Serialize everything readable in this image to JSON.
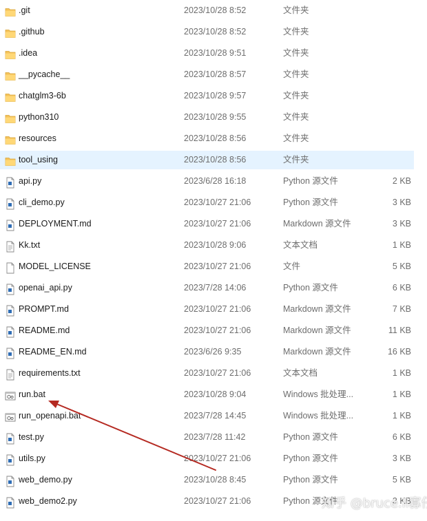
{
  "files": [
    {
      "name": ".git",
      "date": "2023/10/28 8:52",
      "type": "文件夹",
      "size": "",
      "icon": "folder-icon"
    },
    {
      "name": ".github",
      "date": "2023/10/28 8:52",
      "type": "文件夹",
      "size": "",
      "icon": "folder-icon"
    },
    {
      "name": ".idea",
      "date": "2023/10/28 9:51",
      "type": "文件夹",
      "size": "",
      "icon": "folder-icon"
    },
    {
      "name": "__pycache__",
      "date": "2023/10/28 8:57",
      "type": "文件夹",
      "size": "",
      "icon": "folder-icon"
    },
    {
      "name": "chatglm3-6b",
      "date": "2023/10/28 9:57",
      "type": "文件夹",
      "size": "",
      "icon": "folder-icon"
    },
    {
      "name": "python310",
      "date": "2023/10/28 9:55",
      "type": "文件夹",
      "size": "",
      "icon": "folder-icon"
    },
    {
      "name": "resources",
      "date": "2023/10/28 8:56",
      "type": "文件夹",
      "size": "",
      "icon": "folder-icon"
    },
    {
      "name": "tool_using",
      "date": "2023/10/28 8:56",
      "type": "文件夹",
      "size": "",
      "icon": "folder-icon",
      "selected": true
    },
    {
      "name": "api.py",
      "date": "2023/6/28 16:18",
      "type": "Python 源文件",
      "size": "2 KB",
      "icon": "python-file-icon"
    },
    {
      "name": "cli_demo.py",
      "date": "2023/10/27 21:06",
      "type": "Python 源文件",
      "size": "3 KB",
      "icon": "python-file-icon"
    },
    {
      "name": "DEPLOYMENT.md",
      "date": "2023/10/27 21:06",
      "type": "Markdown 源文件",
      "size": "3 KB",
      "icon": "markdown-file-icon"
    },
    {
      "name": "Kk.txt",
      "date": "2023/10/28 9:06",
      "type": "文本文档",
      "size": "1 KB",
      "icon": "text-file-icon"
    },
    {
      "name": "MODEL_LICENSE",
      "date": "2023/10/27 21:06",
      "type": "文件",
      "size": "5 KB",
      "icon": "blank-file-icon"
    },
    {
      "name": "openai_api.py",
      "date": "2023/7/28 14:06",
      "type": "Python 源文件",
      "size": "6 KB",
      "icon": "python-file-icon"
    },
    {
      "name": "PROMPT.md",
      "date": "2023/10/27 21:06",
      "type": "Markdown 源文件",
      "size": "7 KB",
      "icon": "markdown-file-icon"
    },
    {
      "name": "README.md",
      "date": "2023/10/27 21:06",
      "type": "Markdown 源文件",
      "size": "11 KB",
      "icon": "markdown-file-icon"
    },
    {
      "name": "README_EN.md",
      "date": "2023/6/26 9:35",
      "type": "Markdown 源文件",
      "size": "16 KB",
      "icon": "markdown-file-icon"
    },
    {
      "name": "requirements.txt",
      "date": "2023/10/27 21:06",
      "type": "文本文档",
      "size": "1 KB",
      "icon": "text-file-icon"
    },
    {
      "name": "run.bat",
      "date": "2023/10/28 9:04",
      "type": "Windows 批处理...",
      "size": "1 KB",
      "icon": "batch-file-icon"
    },
    {
      "name": "run_openapi.bat",
      "date": "2023/7/28 14:45",
      "type": "Windows 批处理...",
      "size": "1 KB",
      "icon": "batch-file-icon"
    },
    {
      "name": "test.py",
      "date": "2023/7/28 11:42",
      "type": "Python 源文件",
      "size": "6 KB",
      "icon": "python-file-icon"
    },
    {
      "name": "utils.py",
      "date": "2023/10/27 21:06",
      "type": "Python 源文件",
      "size": "3 KB",
      "icon": "python-file-icon"
    },
    {
      "name": "web_demo.py",
      "date": "2023/10/28 8:45",
      "type": "Python 源文件",
      "size": "5 KB",
      "icon": "python-file-icon"
    },
    {
      "name": "web_demo2.py",
      "date": "2023/10/27 21:06",
      "type": "Python 源文件",
      "size": "3 KB",
      "icon": "python-file-icon"
    }
  ],
  "annotation": {
    "color": "#b52a22"
  },
  "watermark": {
    "text": "知乎 @bruce.li寡仔"
  }
}
